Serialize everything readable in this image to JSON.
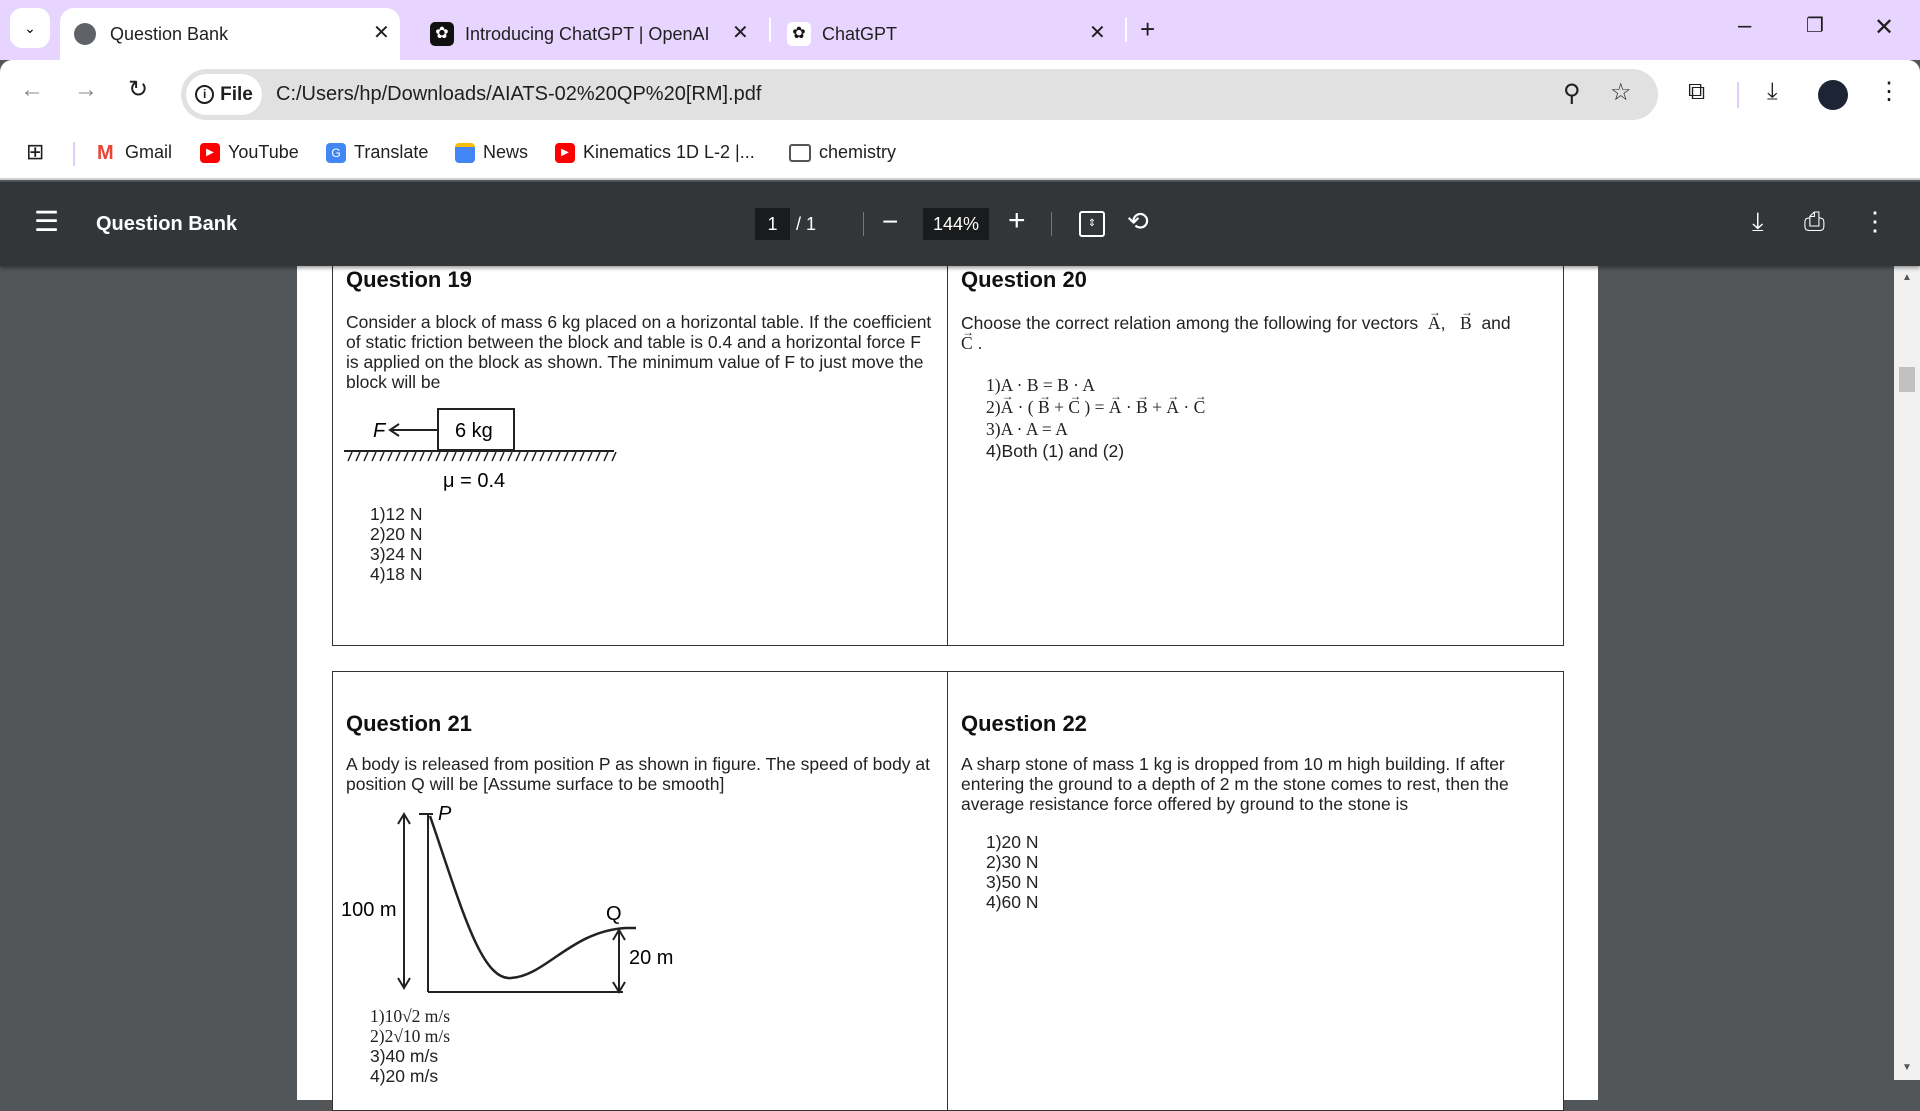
{
  "browser": {
    "tabs": [
      {
        "title": "Question Bank",
        "icon": "globe-icon",
        "active": true
      },
      {
        "title": "Introducing ChatGPT | OpenAI",
        "icon": "openai-icon",
        "active": false
      },
      {
        "title": "ChatGPT",
        "icon": "openai-icon",
        "active": false
      }
    ],
    "address": {
      "chip": "File",
      "url": "C:/Users/hp/Downloads/AIATS-02%20QP%20[RM].pdf"
    },
    "bookmarks": [
      {
        "label": "Gmail",
        "icon": "gmail-icon"
      },
      {
        "label": "YouTube",
        "icon": "youtube-icon"
      },
      {
        "label": "Translate",
        "icon": "translate-icon"
      },
      {
        "label": "News",
        "icon": "news-icon"
      },
      {
        "label": "Kinematics 1D L-2 |...",
        "icon": "youtube-icon"
      },
      {
        "label": "chemistry",
        "icon": "folder-icon"
      }
    ]
  },
  "pdf": {
    "title": "Question Bank",
    "page": "1",
    "total": "/ 1",
    "zoom": "144%",
    "questions": [
      {
        "title": "Question 19",
        "text": "Consider a block of mass 6 kg placed on a horizontal table. If the coefficient of static friction between the block and table is 0.4 and a horizontal force F is applied on the block as shown. The minimum value of F to just move the block will be",
        "figure": {
          "force": "F",
          "mass": "6 kg",
          "mu": "μ = 0.4"
        },
        "options": [
          "1)12 N",
          "2)20 N",
          "3)24 N",
          "4)18 N"
        ]
      },
      {
        "title": "Question 20",
        "text": "Choose the correct relation among the following for vectors",
        "vectors": [
          "A",
          ",",
          "B",
          "and",
          "C",
          "."
        ],
        "options": [
          "1)A · B = B · A",
          "2)A · ( B + C ) = A · B + A · C",
          "3)A · A = A",
          "4)Both (1) and (2)"
        ]
      },
      {
        "title": "Question 21",
        "text": "A body is released from position P as shown in figure. The speed of body at position Q will be [Assume surface to be smooth]",
        "figure": {
          "p": "P",
          "q": "Q",
          "height": "100 m",
          "qheight": "20 m"
        },
        "options": [
          "1)10√2 m/s",
          "2)2√10 m/s",
          "3)40 m/s",
          "4)20 m/s"
        ]
      },
      {
        "title": "Question 22",
        "text": "A sharp stone of mass 1 kg is dropped from 10 m high building. If after entering the ground to a depth of 2 m the stone comes to rest, then the average resistance force offered by ground to the stone is",
        "options": [
          "1)20 N",
          "2)30 N",
          "3)50 N",
          "4)60 N"
        ]
      }
    ]
  },
  "colors": {
    "tabbar": "#e8d5ff",
    "pdf_toolbar": "#323639",
    "viewer_bg": "#525659"
  }
}
